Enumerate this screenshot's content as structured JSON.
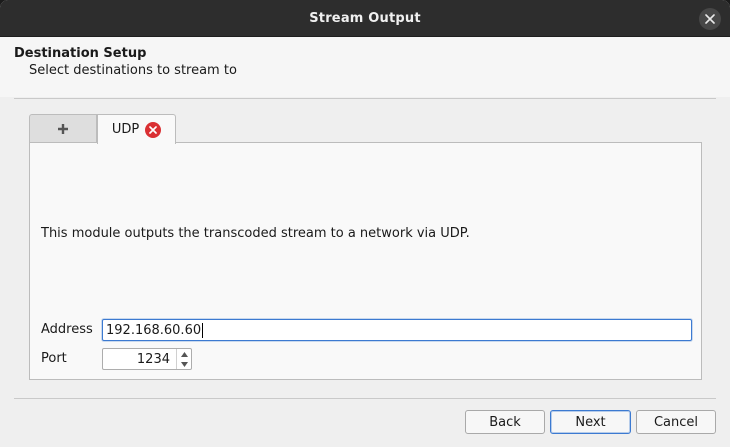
{
  "window": {
    "title": "Stream Output"
  },
  "header": {
    "title": "Destination Setup",
    "subtitle": "Select destinations to stream to"
  },
  "tabs": [
    {
      "label": "+",
      "icon": "plus-icon"
    },
    {
      "label": "UDP",
      "close_icon": "close-tab-icon",
      "active": true
    }
  ],
  "module": {
    "description": "This module outputs the transcoded stream to a network via UDP.",
    "address_label": "Address",
    "address_value": "192.168.60.60",
    "port_label": "Port",
    "port_value": "1234"
  },
  "buttons": {
    "back": "Back",
    "next": "Next",
    "cancel": "Cancel"
  },
  "colors": {
    "accent": "#3c7ad1",
    "tab_close": "#da3033",
    "titlebar": "#2d2d2d"
  }
}
